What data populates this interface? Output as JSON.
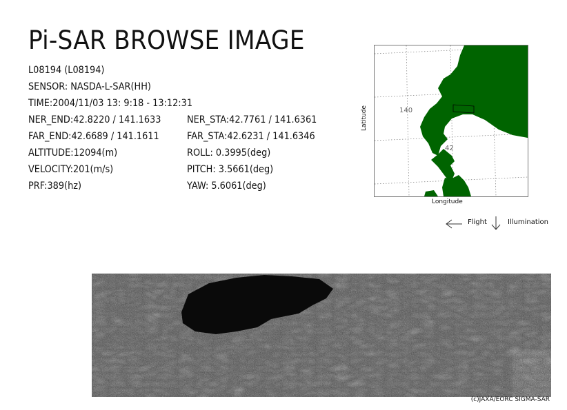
{
  "title": "Pi-SAR BROWSE IMAGE",
  "info": {
    "id": "L08194 (L08194)",
    "sensor": "SENSOR: NASDA-L-SAR(HH)",
    "time": "TIME:2004/11/03  13: 9:18 - 13:12:31",
    "ner_end": "NER_END:42.8220 / 141.1633",
    "ner_sta": "NER_STA:42.7761 / 141.6361",
    "far_end": "FAR_END:42.6689 / 141.1611",
    "far_sta": "FAR_STA:42.6231 / 141.6346",
    "altitude": "ALTITUDE:12094(m)",
    "roll": "ROLL: 0.3995(deg)",
    "velocity": "VELOCITY:201(m/s)",
    "pitch": "PITCH:  3.5661(deg)",
    "prf": "PRF:389(hz)",
    "yaw": "YAW:   5.6061(deg)"
  },
  "map": {
    "ylabel": "Latitude",
    "xlabel": "Longitude",
    "grid_label_lon": "140",
    "grid_label_lat": "42",
    "land_color": "#006400"
  },
  "legend": {
    "flight_label": "Flight",
    "illumination_label": "Illumination",
    "flight_icon": "arrow-left-icon",
    "illumination_icon": "arrow-down-icon"
  },
  "credit": "(c)JAXA/EORC SIGMA-SAR"
}
